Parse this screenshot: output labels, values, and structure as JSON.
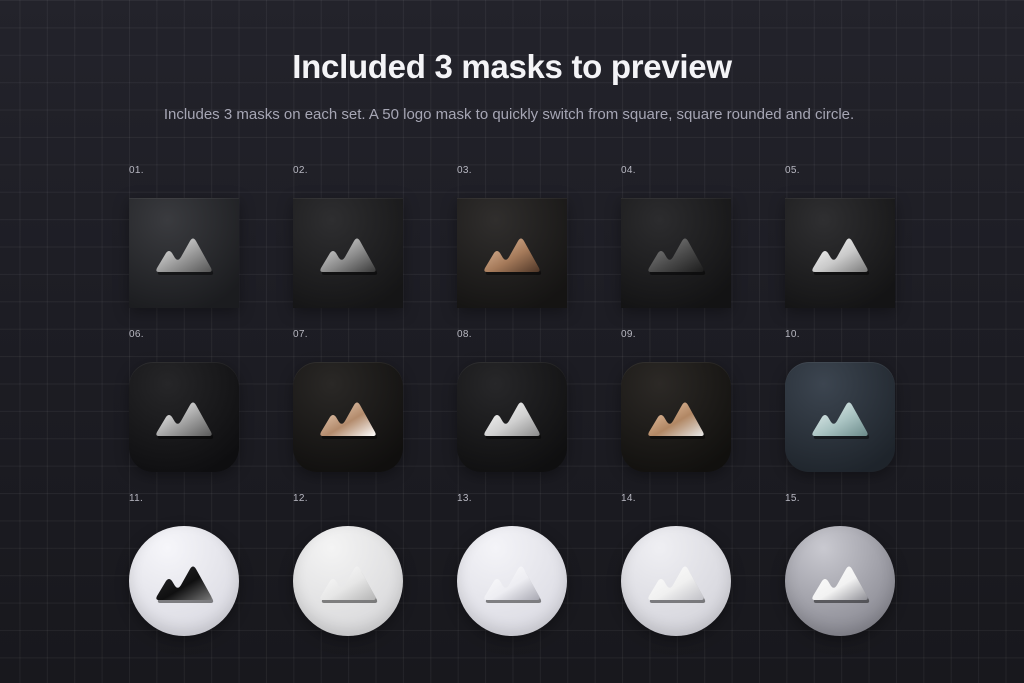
{
  "header": {
    "title": "Included 3 masks to preview",
    "subtitle": "Includes 3 masks on each set. A 50 logo mask to quickly switch from square, square rounded and circle."
  },
  "masks": [
    "square",
    "rounded",
    "circle"
  ],
  "tiles": [
    {
      "number": "01.",
      "mask": "square",
      "bg": [
        "#3a3b3f",
        "#1b1c1f"
      ],
      "logo": [
        "#f2f2f2",
        "#9a9a9a",
        "#555555"
      ]
    },
    {
      "number": "02.",
      "mask": "square",
      "bg": [
        "#2e2e30",
        "#151516"
      ],
      "logo": [
        "#e6e6e6",
        "#8c8c8c",
        "#3a3a3a"
      ]
    },
    {
      "number": "03.",
      "mask": "square",
      "bg": [
        "#302e2d",
        "#151413"
      ],
      "logo": [
        "#e8c3a4",
        "#a57a5a",
        "#4e3627"
      ]
    },
    {
      "number": "04.",
      "mask": "square",
      "bg": [
        "#2c2c2e",
        "#131314"
      ],
      "logo": [
        "#8a8a8a",
        "#4a4a4a",
        "#1c1c1c"
      ]
    },
    {
      "number": "05.",
      "mask": "square",
      "bg": [
        "#2f2f31",
        "#141415"
      ],
      "logo": [
        "#ffffff",
        "#c9c9c9",
        "#7a7a7a"
      ]
    },
    {
      "number": "06.",
      "mask": "rounded",
      "bg": [
        "#262628",
        "#0e0e10"
      ],
      "logo": [
        "#ffffff",
        "#a3a3a3",
        "#5a5a5a"
      ]
    },
    {
      "number": "07.",
      "mask": "rounded",
      "bg": [
        "#2a2826",
        "#100f0e"
      ],
      "logo": [
        "#f5dcc6",
        "#b38b6c",
        "#ffffff"
      ]
    },
    {
      "number": "08.",
      "mask": "rounded",
      "bg": [
        "#272729",
        "#0f0f10"
      ],
      "logo": [
        "#ffffff",
        "#d0d0d0",
        "#8a8a8a"
      ]
    },
    {
      "number": "09.",
      "mask": "rounded",
      "bg": [
        "#2c2926",
        "#11100e"
      ],
      "logo": [
        "#f2cfb0",
        "#b18764",
        "#e9e9e9"
      ]
    },
    {
      "number": "10.",
      "mask": "rounded",
      "bg": [
        "#3c4550",
        "#1e242b"
      ],
      "logo": [
        "#eef6f6",
        "#a9c3c2",
        "#6b8a8a"
      ]
    },
    {
      "number": "11.",
      "mask": "circle",
      "bg": [
        "#f6f6fa",
        "#d9d9e1"
      ],
      "logo": [
        "#2a2a2c",
        "#0f0f10",
        "#777777"
      ]
    },
    {
      "number": "12.",
      "mask": "circle",
      "bg": [
        "#f4f4f4",
        "#d7d7d9"
      ],
      "logo": [
        "#ffffff",
        "#e6e6e6",
        "#b4b4b4"
      ]
    },
    {
      "number": "13.",
      "mask": "circle",
      "bg": [
        "#f4f4f8",
        "#dadae2"
      ],
      "logo": [
        "#ffffff",
        "#ededf2",
        "#a8a8b2"
      ]
    },
    {
      "number": "14.",
      "mask": "circle",
      "bg": [
        "#efeff3",
        "#d3d3da"
      ],
      "logo": [
        "#ffffff",
        "#f0f0f0",
        "#c0c0c6"
      ]
    },
    {
      "number": "15.",
      "mask": "circle",
      "bg": [
        "#c9c9d0",
        "#86868f"
      ],
      "logo": [
        "#ffffff",
        "#f2f2f2",
        "#8f8f96"
      ]
    }
  ]
}
